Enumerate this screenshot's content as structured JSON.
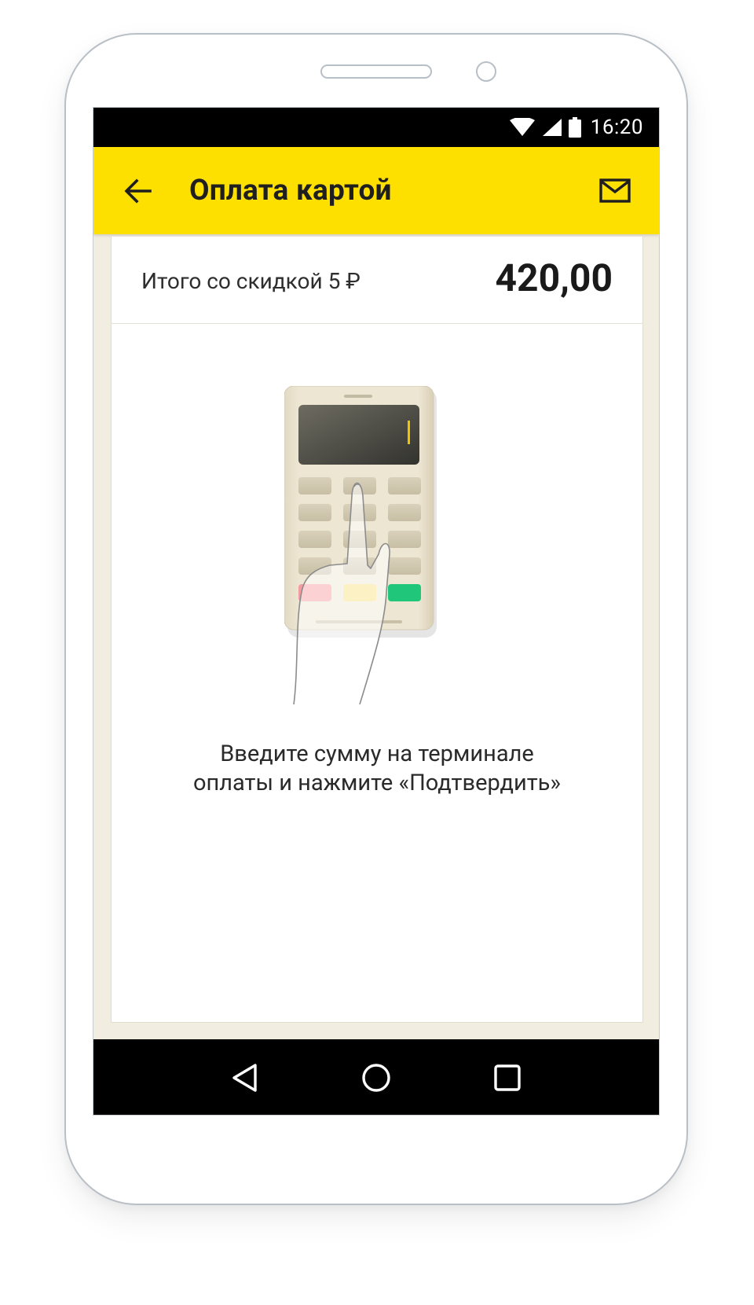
{
  "status_bar": {
    "time": "16:20",
    "icons": [
      "wifi-icon",
      "signal-icon",
      "battery-icon"
    ]
  },
  "app_bar": {
    "title": "Оплата картой",
    "back_icon": "arrow-left-icon",
    "action_icon": "mail-icon",
    "background": "#fddf00"
  },
  "summary": {
    "label": "Итого со скидкой 5 ₽",
    "amount": "420,00"
  },
  "illustration": {
    "icon": "payment-terminal-hand-icon"
  },
  "hint": {
    "line1": "Введите сумму на терминале",
    "line2": "оплаты и нажмите «Подтвердить»"
  },
  "nav_bar": {
    "buttons": [
      "back-triangle-icon",
      "home-circle-icon",
      "recents-square-icon"
    ]
  }
}
